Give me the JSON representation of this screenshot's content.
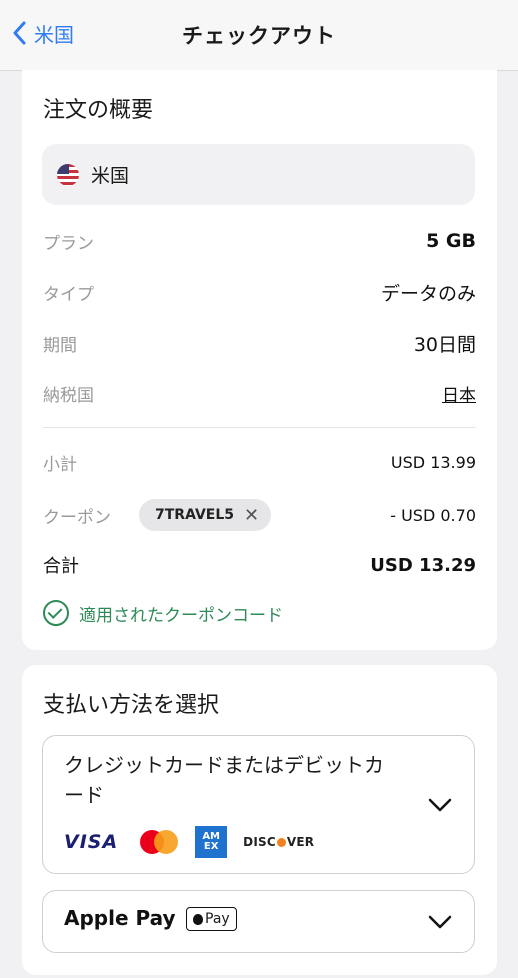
{
  "nav": {
    "back_label": "米国",
    "title": "チェックアウト"
  },
  "summary": {
    "title": "注文の概要",
    "country": "米国",
    "rows": [
      {
        "label": "プラン",
        "value": "5 GB"
      },
      {
        "label": "タイプ",
        "value": "データのみ"
      },
      {
        "label": "期間",
        "value": "30日間"
      },
      {
        "label": "納税国",
        "value": "日本"
      }
    ],
    "subtotal_label": "小計",
    "subtotal_value": "USD 13.99",
    "coupon_label": "クーポン",
    "coupon_code": "7TRAVEL5",
    "coupon_discount": "- USD 0.70",
    "total_label": "合計",
    "total_value": "USD 13.29",
    "applied_message": "適用されたクーポンコード"
  },
  "payment": {
    "title": "支払い方法を選択",
    "card_option_label": "クレジットカードまたはデビットカード",
    "card_brands": [
      "VISA",
      "Mastercard",
      "AMEX",
      "DISCOVER"
    ],
    "apple_pay_label": "Apple Pay",
    "apple_pay_badge": "Pay"
  },
  "colors": {
    "accent": "#2f7cf6",
    "success": "#2e8b57",
    "background": "#f1f1f3"
  }
}
